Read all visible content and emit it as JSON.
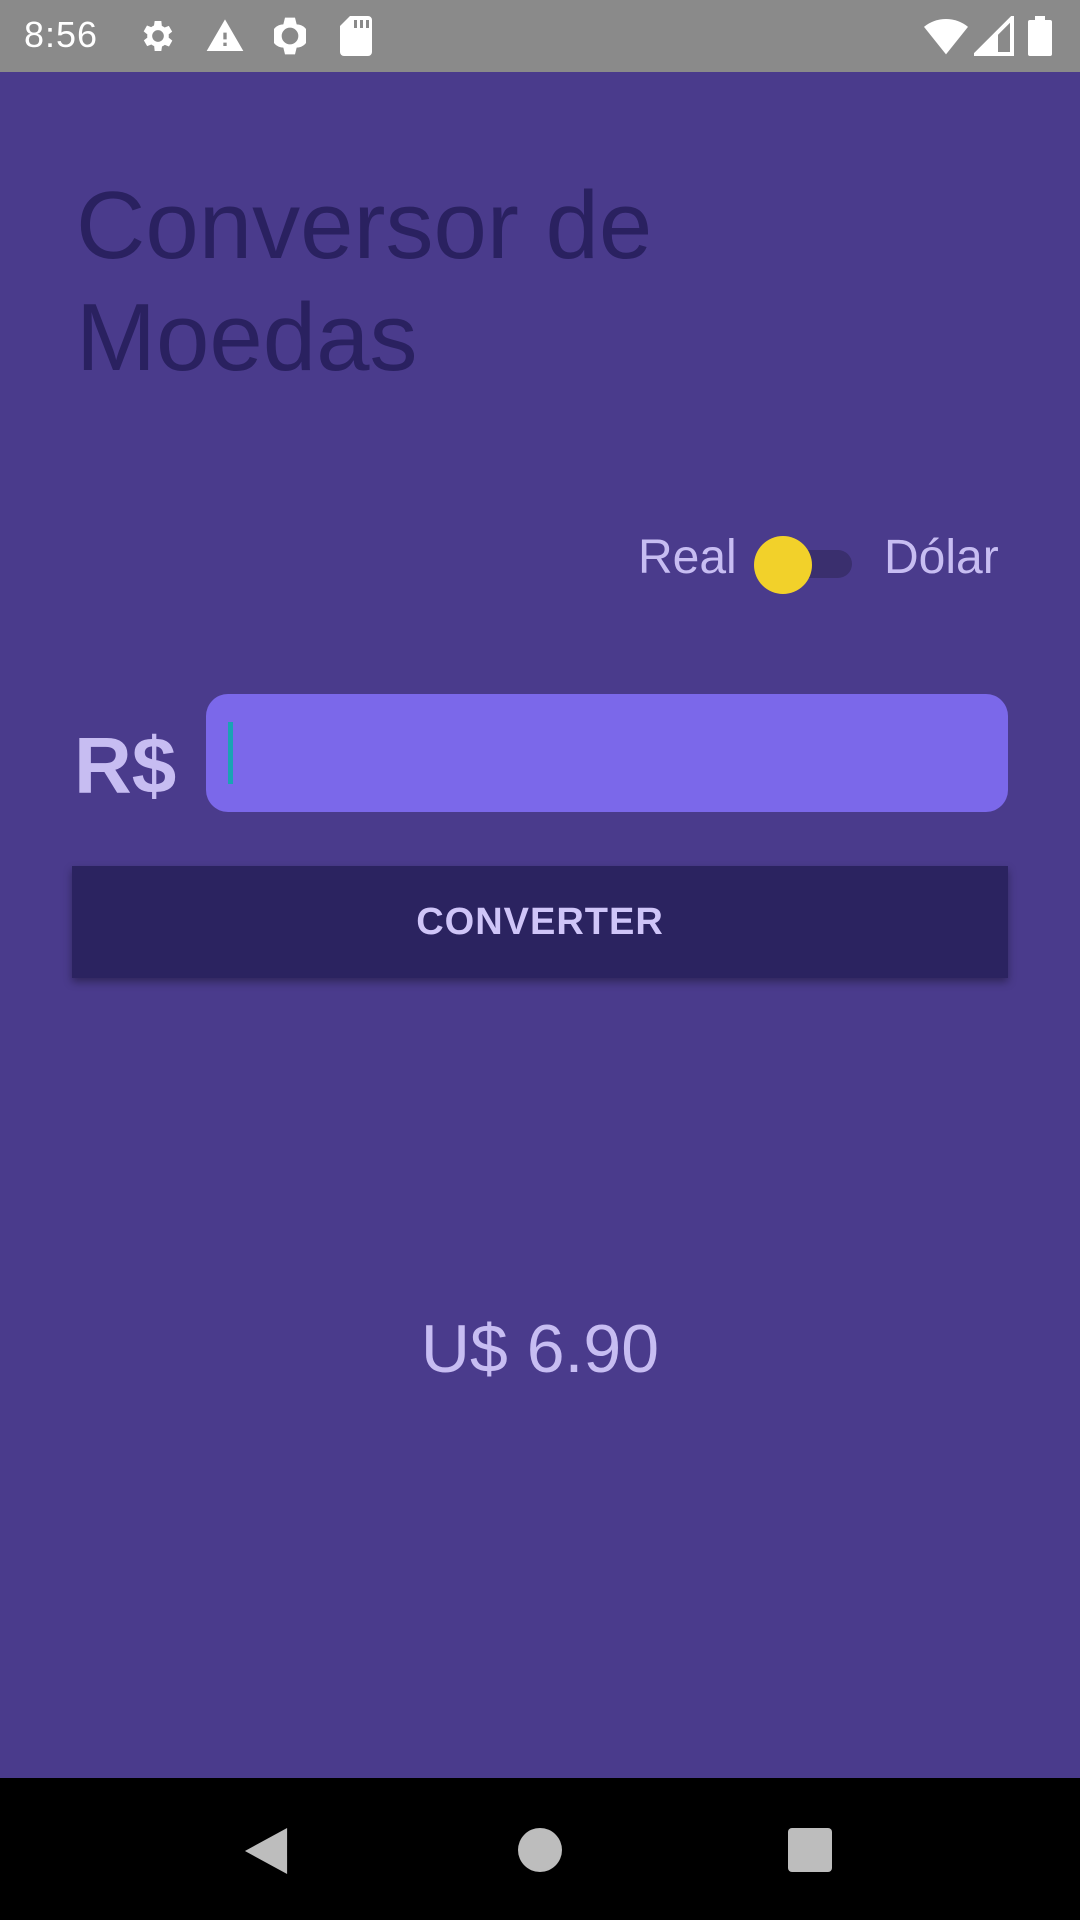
{
  "status_bar": {
    "time": "8:56",
    "icons": [
      "gear-icon",
      "warning-icon",
      "watch-icon",
      "sd-card-icon",
      "wifi-icon",
      "signal-icon",
      "battery-icon"
    ]
  },
  "title": "Conversor de Moedas",
  "toggle": {
    "left_label": "Real",
    "right_label": "Dólar",
    "thumb_color": "#f2d12a"
  },
  "input": {
    "prefix": "R$",
    "value": "",
    "placeholder": ""
  },
  "convert_button": {
    "label": "CONVERTER"
  },
  "result": "U$ 6.90",
  "colors": {
    "background": "#4a3b8c",
    "input_background": "#7b68ea",
    "button_background": "#2b2360",
    "accent_yellow": "#f2d12a"
  },
  "nav_bar": {
    "icons": [
      "back-icon",
      "home-icon",
      "recents-icon"
    ]
  }
}
